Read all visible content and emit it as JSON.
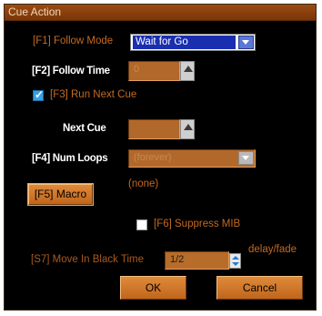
{
  "window": {
    "title": "Cue Action"
  },
  "follow_mode": {
    "label": "[F1] Follow Mode",
    "value": "Wait for Go"
  },
  "follow_time": {
    "label": "[F2] Follow Time",
    "value": "0"
  },
  "run_next_cue": {
    "label": "[F3] Run Next Cue",
    "checked": true
  },
  "next_cue": {
    "label": "Next Cue",
    "value": ""
  },
  "num_loops": {
    "label": "[F4] Num Loops",
    "value": "(forever)"
  },
  "macro": {
    "button_label": "[F5] Macro",
    "value": "(none)"
  },
  "suppress_mib": {
    "label": "[F6] Suppress MIB",
    "checked": false
  },
  "move_in_black": {
    "label": "[S7] Move In Black Time",
    "value": "1/2",
    "unit": "delay/fade"
  },
  "buttons": {
    "ok": "OK",
    "cancel": "Cancel"
  },
  "colors": {
    "background": "#000000",
    "accent": "#c46a22",
    "field": "#b2682a",
    "selection": "#1a2fb0"
  }
}
